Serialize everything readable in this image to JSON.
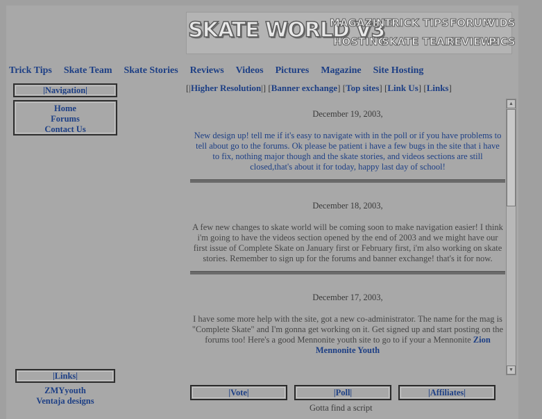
{
  "banner": {
    "logo": "SKATE WORLD V3",
    "links": [
      "MAGAZINE",
      "TRICK TIPS",
      "FORUM",
      "VIDS",
      "HOSTING",
      "SKATE TEAM",
      "REVIEWS",
      "PICS"
    ]
  },
  "topnav": [
    "Trick Tips",
    "Skate Team",
    "Skate Stories",
    "Reviews",
    "Videos",
    "Pictures",
    "Magazine",
    "Site Hosting"
  ],
  "sidebar": {
    "navigation_header": "|Navigation|",
    "nav_items": [
      "Home",
      "Forums",
      "Contact Us"
    ],
    "links_header": "|Links|",
    "links": [
      "ZMYyouth",
      "Ventaja designs"
    ]
  },
  "sublinks": {
    "open": "[|",
    "items": [
      "Higher Resolution",
      "Banner exchange",
      "Top sites",
      "Link Us",
      "Links"
    ]
  },
  "news": [
    {
      "date": "December 19, 2003,",
      "text": "New design up! tell me if it's easy to navigate with in the poll or if you have problems to tell about go to the forums. Ok please be patient i have a few bugs in the site that i have to fix, nothing major though and the skate stories, and videos sections are still closed,that's about it for today, happy last day of school!"
    },
    {
      "date": "December 18, 2003,",
      "text": "A few new changes to skate world will be coming soon to make navigation easier! I think i'm going to have the videos section opened by the end of 2003 and we might have our first issue of Complete Skate on January first or February first, i'm also working on skate stories. Remember to sign up for the forums and banner exchange! that's it for now."
    },
    {
      "date": "December 17, 2003,",
      "text": "I have some more help with the site, got a new co-administrator. The name for the mag is \"Complete Skate\" and I'm gonna get working on it. Get signed up and start posting on the forums too! Here's a good Mennonite youth site to go to if your a Mennonite",
      "link": "Zion Mennonite Youth"
    }
  ],
  "bottom": {
    "vote": "|Vote|",
    "poll": "|Poll|",
    "affiliates": "|Affiliates|",
    "script_text": "Gotta find a script"
  }
}
